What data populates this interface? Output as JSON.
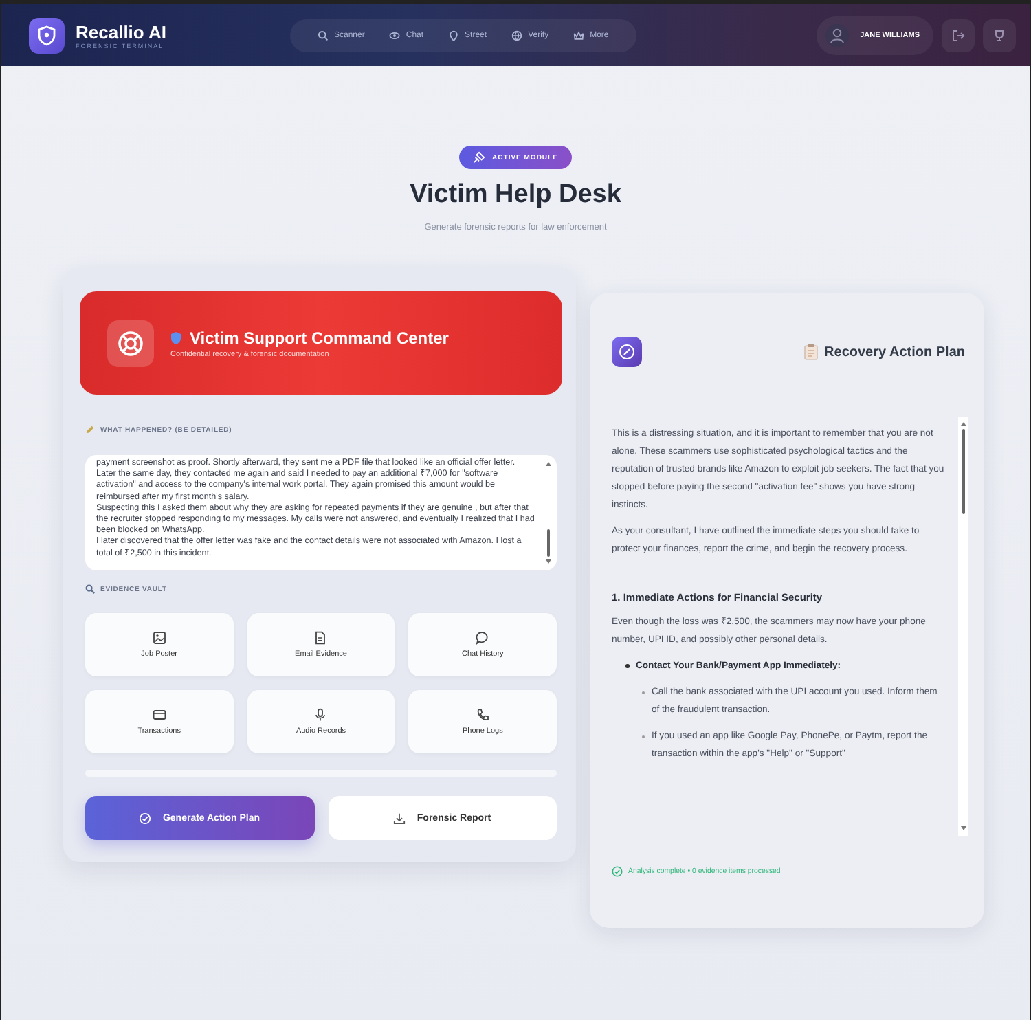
{
  "app": {
    "name": "Recallio AI",
    "tagline": "FORENSIC TERMINAL"
  },
  "nav": [
    {
      "label": "Scanner",
      "selected": false
    },
    {
      "label": "Chat",
      "selected": false
    },
    {
      "label": "Street",
      "selected": false
    },
    {
      "label": "Verify",
      "selected": false
    },
    {
      "label": "More",
      "selected": false
    }
  ],
  "user": {
    "name": "JANE WILLIAMS"
  },
  "hero": {
    "badge": "ACTIVE MODULE",
    "title": "Victim Help Desk",
    "subtitle": "Generate forensic reports for law enforcement"
  },
  "command_center": {
    "title": "Victim Support Command Center",
    "subtitle": "Confidential recovery & forensic documentation",
    "story_label": "WHAT HAPPENED? (BE DETAILED)",
    "story": "payment screenshot as proof. Shortly afterward, they sent me a PDF file that looked like an official offer letter.\nLater the same day, they contacted me again and said I needed to pay an additional ₹7,000 for \"software activation\" and access to the company's internal work portal. They again promised this amount would be reimbursed after my first month's salary.\nSuspecting this I asked them about why they are asking for repeated payments if they are genuine , but after that the recruiter stopped responding to my messages. My calls were not answered, and eventually I realized that I had been blocked on WhatsApp.\nI later discovered that the offer letter was fake and the contact details were not associated with Amazon. I lost a total of ₹2,500 in this incident.",
    "evidence_label": "EVIDENCE VAULT",
    "evidence": [
      {
        "label": "Job Poster"
      },
      {
        "label": "Email Evidence"
      },
      {
        "label": "Chat History"
      },
      {
        "label": "Transactions"
      },
      {
        "label": "Audio Records"
      },
      {
        "label": "Phone Logs"
      }
    ],
    "buttons": [
      {
        "label": "Generate Action Plan",
        "kind": "primary"
      },
      {
        "label": "Forensic Report",
        "kind": "secondary"
      }
    ]
  },
  "plan": {
    "title": "Recovery Action Plan",
    "content": [
      {
        "kind": "p",
        "text": "This is a distressing situation, and it is important to remember that you are not alone. These scammers use sophisticated psychological tactics and the reputation of trusted brands like Amazon to exploit job seekers. The fact that you stopped before paying the second \"activation fee\" shows you have strong instincts."
      },
      {
        "kind": "p",
        "text": "As your consultant, I have outlined the immediate steps you should take to protect your finances, report the crime, and begin the recovery process."
      },
      {
        "kind": "h",
        "text": "1. Immediate Actions for Financial Security"
      },
      {
        "kind": "p",
        "text": "Even though the loss was ₹2,500, the scammers may now have your phone number, UPI ID, and possibly other personal details."
      },
      {
        "kind": "li",
        "text": "Contact Your Bank/Payment App Immediately:",
        "children": [
          {
            "text": "Call the bank associated with the UPI account you used. Inform them of the fraudulent transaction."
          },
          {
            "text": "If you used an app like Google Pay, PhonePe, or Paytm, report the transaction within the app's \"Help\" or \"Support\""
          }
        ]
      }
    ],
    "status": "Analysis complete • 0 evidence items processed"
  }
}
